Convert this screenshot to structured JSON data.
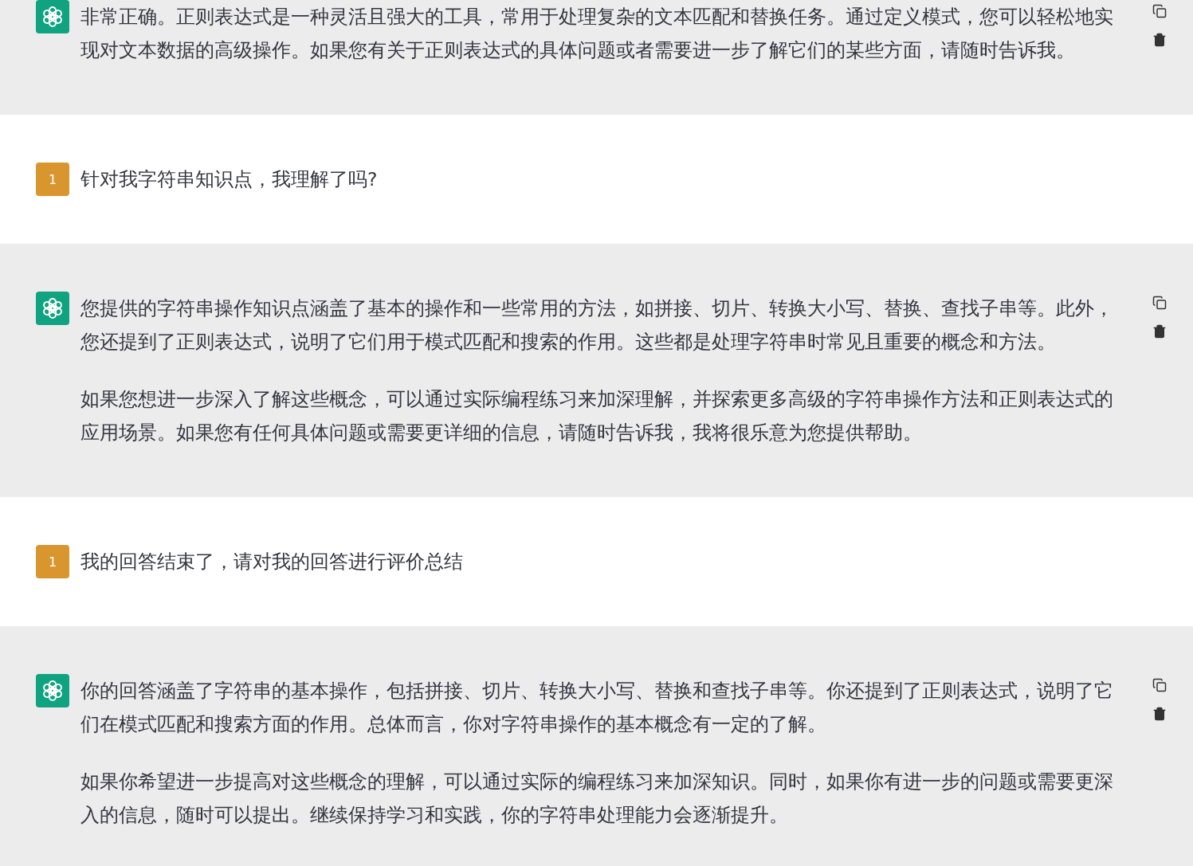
{
  "messages": [
    {
      "kind": "assistant",
      "paragraphs": [
        "非常正确。正则表达式是一种灵活且强大的工具，常用于处理复杂的文本匹配和替换任务。通过定义模式，您可以轻松地实现对文本数据的高级操作。如果您有关于正则表达式的具体问题或者需要进一步了解它们的某些方面，请随时告诉我。"
      ]
    },
    {
      "kind": "user",
      "avatar_label": "1",
      "paragraphs": [
        "针对我字符串知识点，我理解了吗?"
      ]
    },
    {
      "kind": "assistant",
      "paragraphs": [
        "您提供的字符串操作知识点涵盖了基本的操作和一些常用的方法，如拼接、切片、转换大小写、替换、查找子串等。此外，您还提到了正则表达式，说明了它们用于模式匹配和搜索的作用。这些都是处理字符串时常见且重要的概念和方法。",
        "如果您想进一步深入了解这些概念，可以通过实际编程练习来加深理解，并探索更多高级的字符串操作方法和正则表达式的应用场景。如果您有任何具体问题或需要更详细的信息，请随时告诉我，我将很乐意为您提供帮助。"
      ]
    },
    {
      "kind": "user",
      "avatar_label": "1",
      "paragraphs": [
        "我的回答结束了，请对我的回答进行评价总结"
      ]
    },
    {
      "kind": "assistant",
      "paragraphs": [
        "你的回答涵盖了字符串的基本操作，包括拼接、切片、转换大小写、替换和查找子串等。你还提到了正则表达式，说明了它们在模式匹配和搜索方面的作用。总体而言，你对字符串操作的基本概念有一定的了解。",
        "如果你希望进一步提高对这些概念的理解，可以通过实际的编程练习来加深知识。同时，如果你有进一步的问题或需要更深入的信息，随时可以提出。继续保持学习和实践，你的字符串处理能力会逐渐提升。"
      ]
    }
  ]
}
